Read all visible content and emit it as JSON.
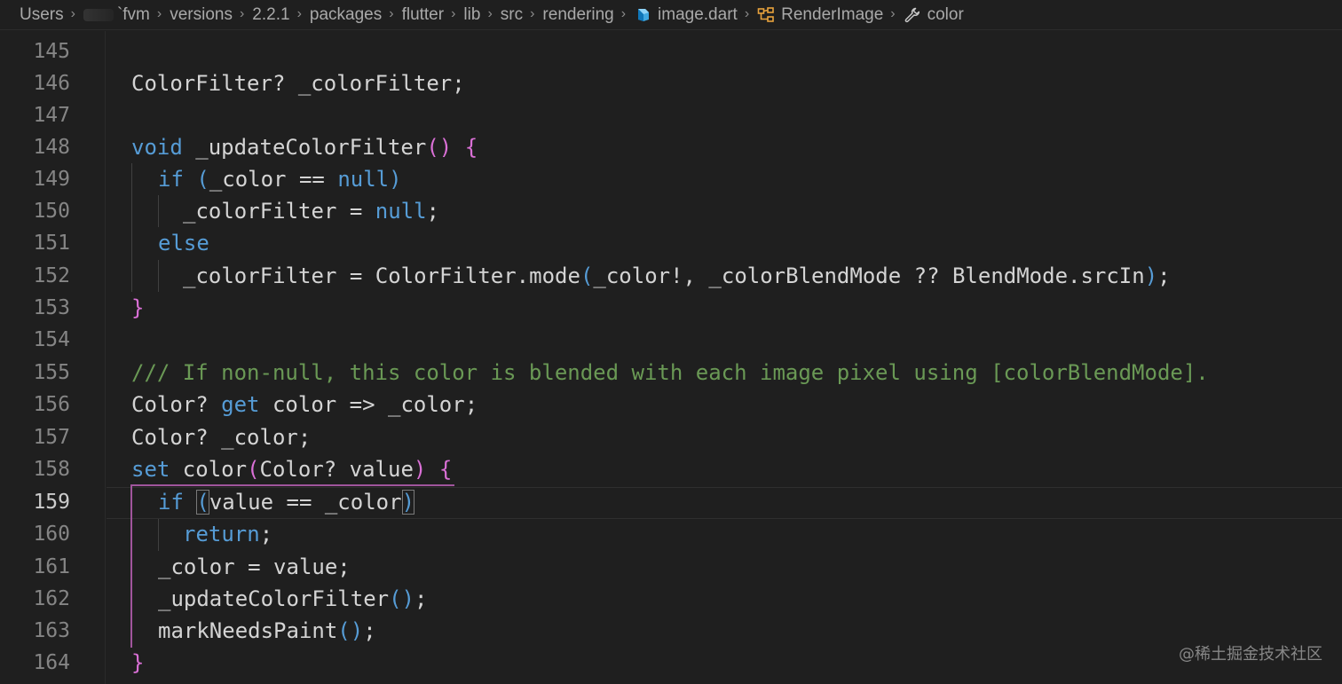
{
  "breadcrumb": {
    "items": [
      "Users",
      "fvm",
      "versions",
      "2.2.1",
      "packages",
      "flutter",
      "lib",
      "src",
      "rendering",
      "image.dart",
      "RenderImage",
      "color"
    ],
    "icons": {
      "image.dart": "dart-file-icon",
      "RenderImage": "class-icon",
      "color": "wrench-property-icon"
    }
  },
  "editor": {
    "active_line": "159",
    "lines": [
      {
        "num": "145"
      },
      {
        "num": "146",
        "t": [
          "ColorFilter? _colorFilter;"
        ]
      },
      {
        "num": "147"
      },
      {
        "num": "148",
        "t": [
          "void",
          " _updateColorFilter",
          "(",
          ")",
          " ",
          "{"
        ]
      },
      {
        "num": "149",
        "t": [
          "if",
          " ",
          "(",
          "_color == ",
          "null",
          ")"
        ]
      },
      {
        "num": "150",
        "t": [
          "_colorFilter = ",
          "null",
          ";"
        ]
      },
      {
        "num": "151",
        "t": [
          "else"
        ]
      },
      {
        "num": "152",
        "t": [
          "_colorFilter = ColorFilter.mode",
          "(",
          "_color!, _colorBlendMode ?? BlendMode.srcIn",
          ")",
          ";"
        ]
      },
      {
        "num": "153",
        "t": [
          "}"
        ]
      },
      {
        "num": "154"
      },
      {
        "num": "155",
        "t": [
          "/// If non-null, this color is blended with each image pixel using [colorBlendMode]."
        ]
      },
      {
        "num": "156",
        "t": [
          "Color? ",
          "get",
          " color => _color;"
        ]
      },
      {
        "num": "157",
        "t": [
          "Color? _color;"
        ]
      },
      {
        "num": "158",
        "t": [
          "set",
          " color",
          "(",
          "Color? value",
          ")",
          " ",
          "{"
        ]
      },
      {
        "num": "159",
        "t": [
          "if",
          " ",
          "(",
          "value == _color",
          ")"
        ]
      },
      {
        "num": "160",
        "t": [
          "return",
          ";"
        ]
      },
      {
        "num": "161",
        "t": [
          "_color = value;"
        ]
      },
      {
        "num": "162",
        "t": [
          "_updateColorFilter",
          "(",
          ")",
          ";"
        ]
      },
      {
        "num": "163",
        "t": [
          "markNeedsPaint",
          "(",
          ")",
          ";"
        ]
      },
      {
        "num": "164",
        "t": [
          "}"
        ]
      }
    ]
  },
  "colors": {
    "background": "#1f1f1f",
    "keyword": "#569cd6",
    "comment": "#6a9955",
    "bracket_level1": "#da70d6",
    "bracket_level2": "#569cd6",
    "text": "#d4d4d4"
  },
  "watermark": "@稀土掘金技术社区"
}
